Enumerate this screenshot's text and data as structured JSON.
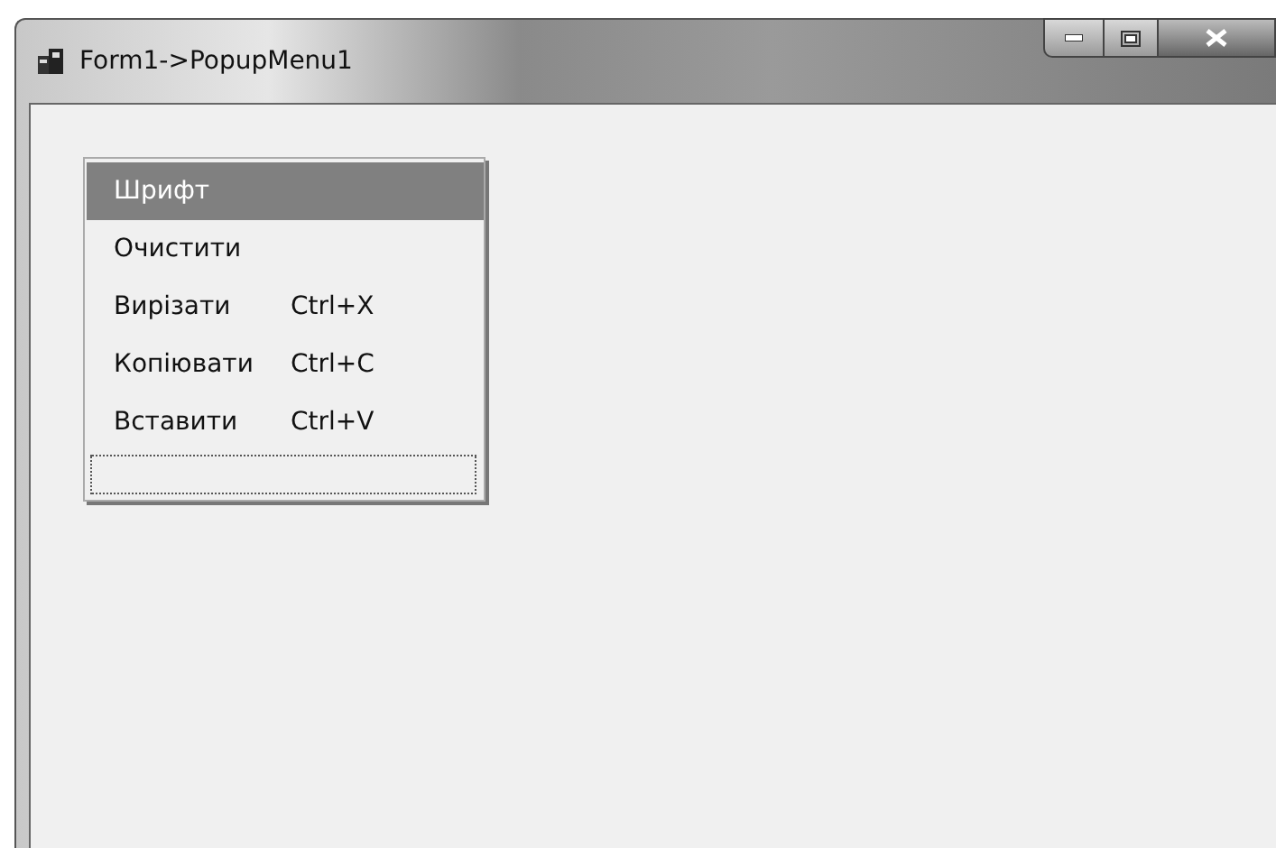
{
  "window": {
    "title": "Form1->PopupMenu1"
  },
  "menu": {
    "items": [
      {
        "kind": "item",
        "label": "Шрифт",
        "selected": true
      },
      {
        "kind": "item",
        "label": "Очистити",
        "selected": false
      },
      {
        "kind": "item",
        "label": "Вирізати",
        "shortcut": "Ctrl+X",
        "selected": false
      },
      {
        "kind": "item",
        "label": "Копіювати",
        "shortcut": "Ctrl+C",
        "selected": false
      },
      {
        "kind": "item",
        "label": "Вставити",
        "shortcut": "Ctrl+V",
        "selected": false
      },
      {
        "kind": "new-slot",
        "selected": false
      }
    ]
  }
}
